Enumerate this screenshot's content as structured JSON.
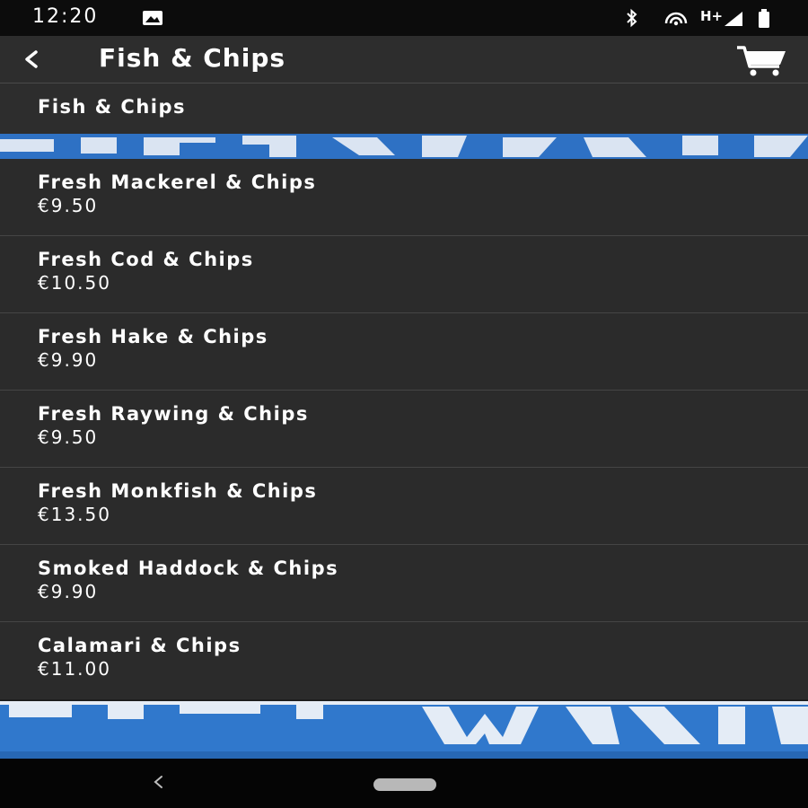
{
  "status_bar": {
    "time": "12:20",
    "network_type": "H+",
    "icons": [
      "image-notification-icon",
      "bluetooth-icon",
      "hotspot-icon",
      "signal-icon",
      "battery-icon"
    ]
  },
  "app_bar": {
    "title": "Fish & Chips",
    "back_icon": "back-arrow-icon",
    "cart_icon": "cart-icon"
  },
  "category": {
    "label": "Fish & Chips"
  },
  "menu": {
    "items": [
      {
        "name": "Fresh Mackerel & Chips",
        "price": "€9.50"
      },
      {
        "name": "Fresh Cod & Chips",
        "price": "€10.50"
      },
      {
        "name": "Fresh Hake & Chips",
        "price": "€9.90"
      },
      {
        "name": "Fresh Raywing & Chips",
        "price": "€9.50"
      },
      {
        "name": "Fresh Monkfish & Chips",
        "price": "€13.50"
      },
      {
        "name": "Smoked Haddock & Chips",
        "price": "€9.90"
      },
      {
        "name": "Calamari & Chips",
        "price": "€11.00"
      }
    ]
  },
  "nav_bar": {
    "back_icon": "nav-back-icon",
    "home_icon": "home-pill-icon"
  },
  "colors": {
    "status_bar_bg": "#0c0c0c",
    "app_bar_bg": "#2d2d2d",
    "list_bg": "#2b2b2b",
    "divider": "#454545",
    "banner_blue": "#2e71c4",
    "text": "#ffffff"
  }
}
